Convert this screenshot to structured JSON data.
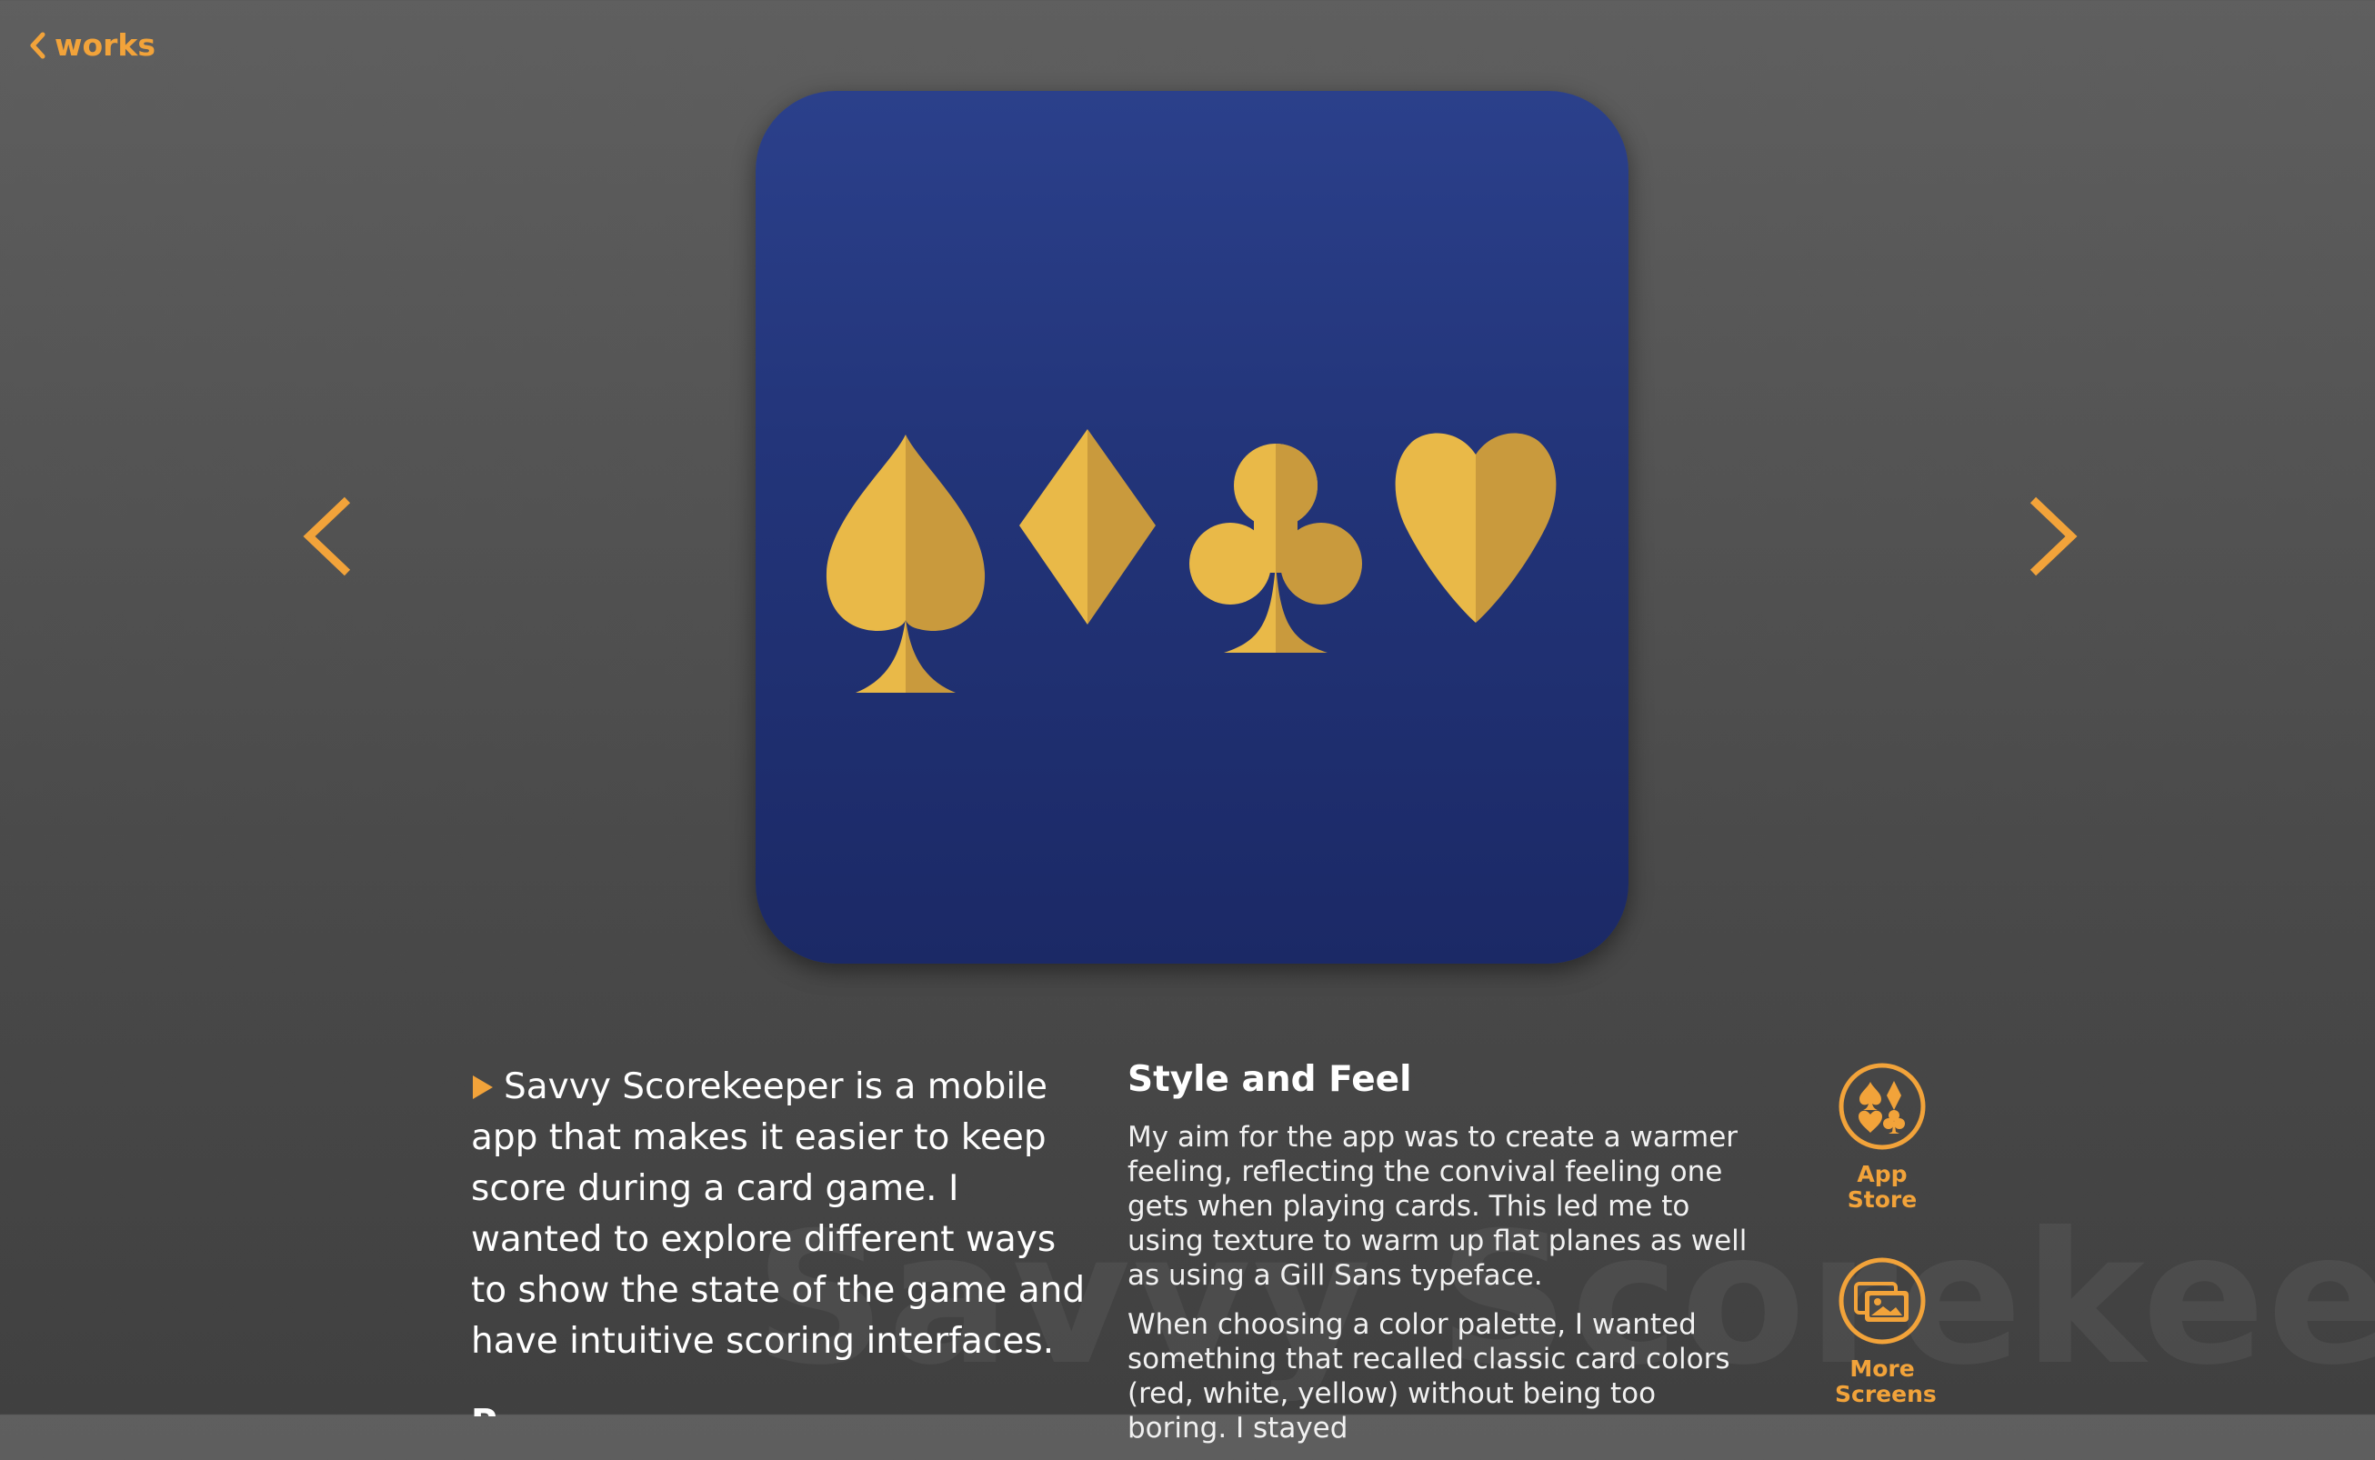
{
  "nav": {
    "back_label": "works"
  },
  "hero": {
    "icon_name": "card-suits-app-icon",
    "suits": [
      "spade-icon",
      "diamond-icon",
      "club-icon",
      "heart-icon"
    ],
    "background_top": "#2b408b",
    "background_bottom": "#1b2966",
    "suit_color": "#e9b948",
    "suit_shade": "#c99a3d"
  },
  "carousel": {
    "prev_icon": "chevron-left-icon",
    "next_icon": "chevron-right-icon"
  },
  "watermark": "Savvy Scorekeeper",
  "intro": {
    "text": "Savvy Scorekeeper is a mobile app that makes it easier to keep score during a card game. I wanted to explore different ways to show the state of the game and have intuitive scoring interfaces.",
    "next_partial": "P"
  },
  "style_section": {
    "heading": "Style and Feel",
    "paragraphs": [
      "My aim for the app was to create a warmer feeling, reflecting the convival feeling one gets when playing cards. This led me to using texture to warm up flat planes as well as using a Gill Sans typeface.",
      "When choosing a color palette, I wanted something that recalled classic card colors (red, white, yellow) without being too boring. I stayed"
    ]
  },
  "side_links": {
    "app_store": {
      "label_line1": "App",
      "label_line2": "Store",
      "icon": "card-suits-circle-icon"
    },
    "more_screens": {
      "label_line1": "More",
      "label_line2": "Screens",
      "icon": "image-gallery-circle-icon"
    }
  },
  "colors": {
    "accent": "#f2a33a",
    "background_top": "#5f5f5f",
    "background_bottom": "#404040",
    "text": "#ffffff"
  }
}
